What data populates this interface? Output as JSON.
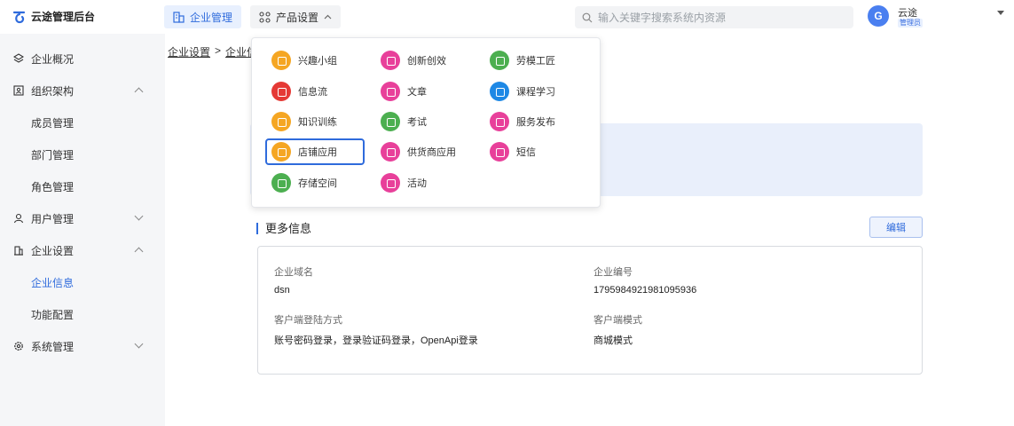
{
  "app": {
    "title": "云途管理后台"
  },
  "topnav": {
    "company_label": "企业管理",
    "product_label": "产品设置"
  },
  "search": {
    "placeholder": "输入关键字搜索系统内资源"
  },
  "user": {
    "avatar_letter": "G",
    "name": "云途",
    "role": "管理员"
  },
  "sidebar": {
    "items": [
      {
        "label": "企业概况",
        "icon": "layers-icon"
      },
      {
        "label": "组织架构",
        "icon": "org-icon",
        "expanded": true
      },
      {
        "label": "成员管理"
      },
      {
        "label": "部门管理"
      },
      {
        "label": "角色管理"
      },
      {
        "label": "用户管理",
        "icon": "user-icon",
        "expanded": false
      },
      {
        "label": "企业设置",
        "icon": "building-icon",
        "expanded": true
      },
      {
        "label": "企业信息",
        "active": true
      },
      {
        "label": "功能配置"
      },
      {
        "label": "系统管理",
        "icon": "gear-icon",
        "expanded": false
      }
    ]
  },
  "breadcrumb": {
    "first": "企业设置",
    "separator": ">",
    "second": "企业信"
  },
  "section": {
    "title": "更多信息",
    "edit_label": "编辑"
  },
  "info": {
    "domain_label": "企业域名",
    "domain_value": "dsn",
    "code_label": "企业编号",
    "code_value": "1795984921981095936",
    "login_label": "客户端登陆方式",
    "login_value": "账号密码登录，登录验证码登录，OpenApi登录",
    "mode_label": "客户端模式",
    "mode_value": "商城模式"
  },
  "product_menu": {
    "items": [
      {
        "label": "兴趣小组",
        "color": "#f5a623"
      },
      {
        "label": "创新创效",
        "color": "#e8409a"
      },
      {
        "label": "劳模工匠",
        "color": "#4caf50"
      },
      {
        "label": "信息流",
        "color": "#e53935"
      },
      {
        "label": "文章",
        "color": "#e8409a"
      },
      {
        "label": "课程学习",
        "color": "#1e88e5"
      },
      {
        "label": "知识训练",
        "color": "#f5a623"
      },
      {
        "label": "考试",
        "color": "#4caf50"
      },
      {
        "label": "服务发布",
        "color": "#e8409a"
      },
      {
        "label": "店铺应用",
        "color": "#f5a623",
        "selected": true
      },
      {
        "label": "供货商应用",
        "color": "#e8409a"
      },
      {
        "label": "短信",
        "color": "#e8409a"
      },
      {
        "label": "存储空间",
        "color": "#4caf50"
      },
      {
        "label": "活动",
        "color": "#e8409a"
      }
    ]
  }
}
